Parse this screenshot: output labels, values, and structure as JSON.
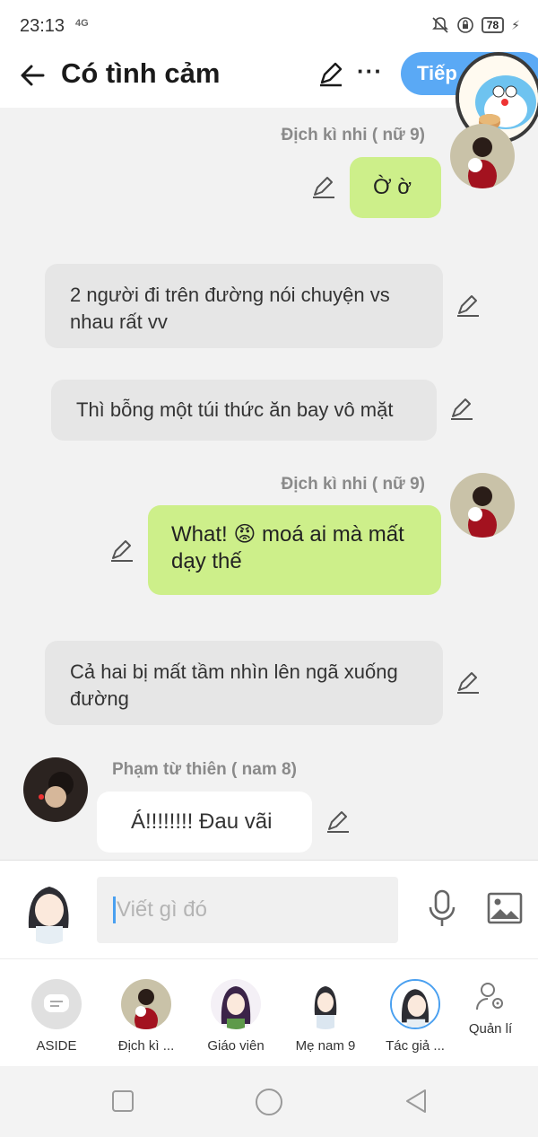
{
  "status_bar": {
    "time": "23:13",
    "network": "4G",
    "battery": "78"
  },
  "header": {
    "title": "Có tình cảm",
    "next_label": "Tiếp"
  },
  "messages": [
    {
      "type": "right",
      "sender": "Địch kì nhi ( nữ 9)",
      "text": "Ờ ờ"
    },
    {
      "type": "narration",
      "text": "2 người đi trên đường nói chuyện vs nhau rất vv"
    },
    {
      "type": "narration",
      "text": "Thì bỗng một túi thức ăn bay vô mặt"
    },
    {
      "type": "right",
      "sender": "Địch kì nhi ( nữ 9)",
      "text": "What! 😡 moá ai mà mất dạy thế"
    },
    {
      "type": "narration",
      "text": "Cả hai bị mất tầm nhìn lên ngã xuống đường"
    },
    {
      "type": "left",
      "sender": "Phạm từ thiên ( nam 8)",
      "text": "Á!!!!!!!!  Đau vãi"
    }
  ],
  "input": {
    "placeholder": "Viết gì đó"
  },
  "characters": [
    {
      "label": "ASIDE"
    },
    {
      "label": "Địch kì ..."
    },
    {
      "label": "Giáo viên"
    },
    {
      "label": "Mẹ nam 9"
    },
    {
      "label": "Tác giả ..."
    }
  ],
  "manage_label": "Quản lí",
  "colors": {
    "accent": "#5aa9f5",
    "green_bubble": "#cdef8a",
    "gray_bubble": "#e6e6e6"
  }
}
